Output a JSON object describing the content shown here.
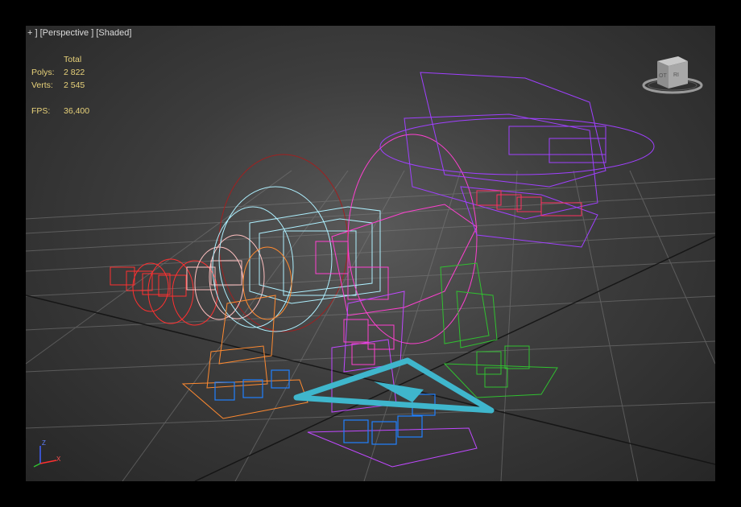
{
  "viewport": {
    "menu": {
      "plus": "+",
      "view": "Perspective",
      "shading": "Shaded"
    },
    "stats": {
      "header": "Total",
      "polys_label": "Polys:",
      "polys_value": "2 822",
      "verts_label": "Verts:",
      "verts_value": "2 545",
      "fps_label": "FPS:",
      "fps_value": "36,400"
    },
    "view_cube": {
      "face_left": "OT",
      "face_right": "RI"
    },
    "axis_tripod": {
      "z": "Z",
      "x": "X"
    }
  },
  "colors": {
    "background": "#3d3d3d",
    "grid": "#8a8a8a",
    "stats_text": "#e8d27a",
    "rig_red": "#ff3030",
    "rig_orange": "#ff8a30",
    "rig_cyan": "#aef0ff",
    "rig_magenta": "#ff40d0",
    "rig_purple": "#a040ff",
    "rig_green": "#30c030",
    "rig_blue": "#2080ff",
    "root_arrow": "#40c8e0"
  }
}
